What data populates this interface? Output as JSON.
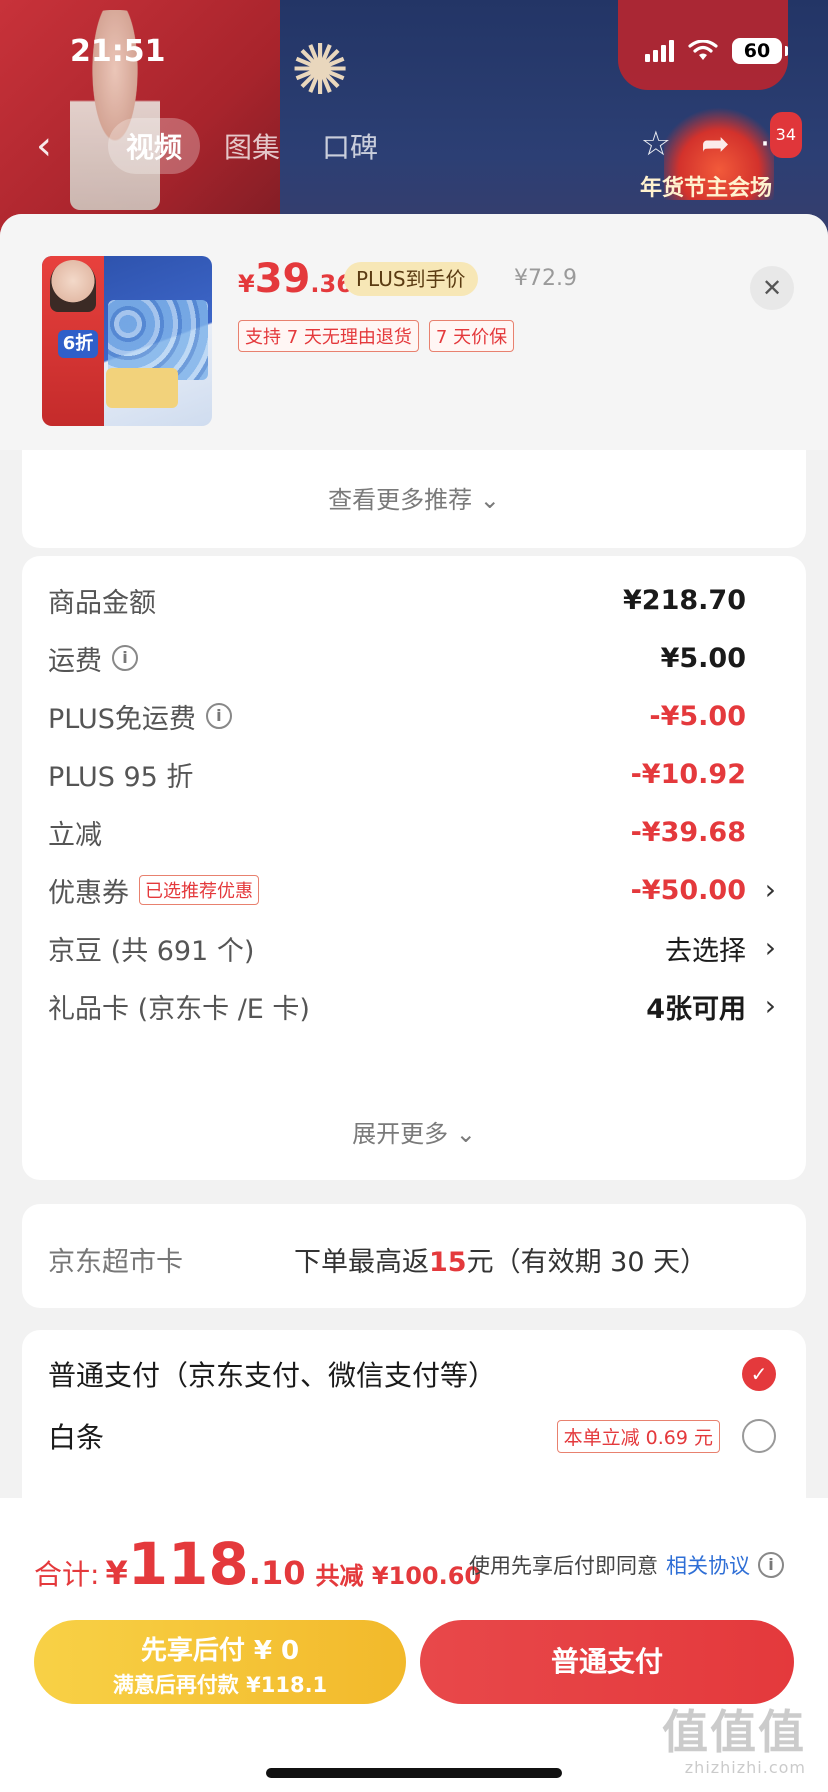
{
  "status_bar": {
    "time": "21:51",
    "battery": "60"
  },
  "top_nav": {
    "back_icon": "chevron-left-icon",
    "tabs": [
      {
        "label": "视频"
      },
      {
        "label": "图集"
      },
      {
        "label": "口碑"
      }
    ],
    "more_count": "34",
    "banner_promo": "年货节主会场"
  },
  "product": {
    "price_symbol": "¥",
    "price_int": "39",
    "price_dec": ".36",
    "plus_label": "PLUS到手价",
    "original_price": "¥72.9",
    "tags": [
      "支持 7 天无理由退货",
      "7 天价保"
    ],
    "thumb_discount": "6折"
  },
  "recommend": {
    "more_label": "查看更多推荐 ⌄"
  },
  "summary": {
    "rows": [
      {
        "label": "商品金额",
        "value": "¥218.70"
      },
      {
        "label": "运费",
        "value": "¥5.00"
      },
      {
        "label": "PLUS免运费",
        "value": "-¥5.00"
      },
      {
        "label": "PLUS 95 折",
        "value": "-¥10.92"
      },
      {
        "label": "立减",
        "value": "-¥39.68"
      },
      {
        "label": "优惠券",
        "tag": "已选推荐优惠",
        "value": "-¥50.00"
      },
      {
        "label": "京豆 (共 691 个)",
        "value": "去选择"
      },
      {
        "label": "礼品卡 (京东卡 /E 卡)",
        "value": "4张可用"
      }
    ],
    "expand_label": "展开更多 ⌄"
  },
  "supermarket": {
    "label": "京东超市卡",
    "text_before": "下单最高返",
    "amount": "15",
    "text_after": "元（有效期 30 天）"
  },
  "payment": {
    "options": [
      {
        "label": "普通支付（京东支付、微信支付等）",
        "selected": true
      },
      {
        "label": "白条",
        "tag": "本单立减 0.69 元",
        "selected": false
      }
    ]
  },
  "bottom": {
    "total_label": "合计:",
    "total_yen": "¥",
    "total_int": "118",
    "total_dec": ".10",
    "total_saved": "共减 ¥100.60",
    "agree_text": "使用先享后付即同意",
    "agree_link": "相关协议",
    "btn_later_main": "先享后付 ¥ 0",
    "btn_later_sub": "满意后再付款 ¥118.1",
    "btn_normal": "普通支付",
    "watermark_big": "值值值",
    "watermark_small": "zhizhizhi.com"
  },
  "colors": {
    "accent_red": "#e4393c",
    "pay_later_yellow": "#f2b92b",
    "plus_gold": "#f7e7b6"
  }
}
